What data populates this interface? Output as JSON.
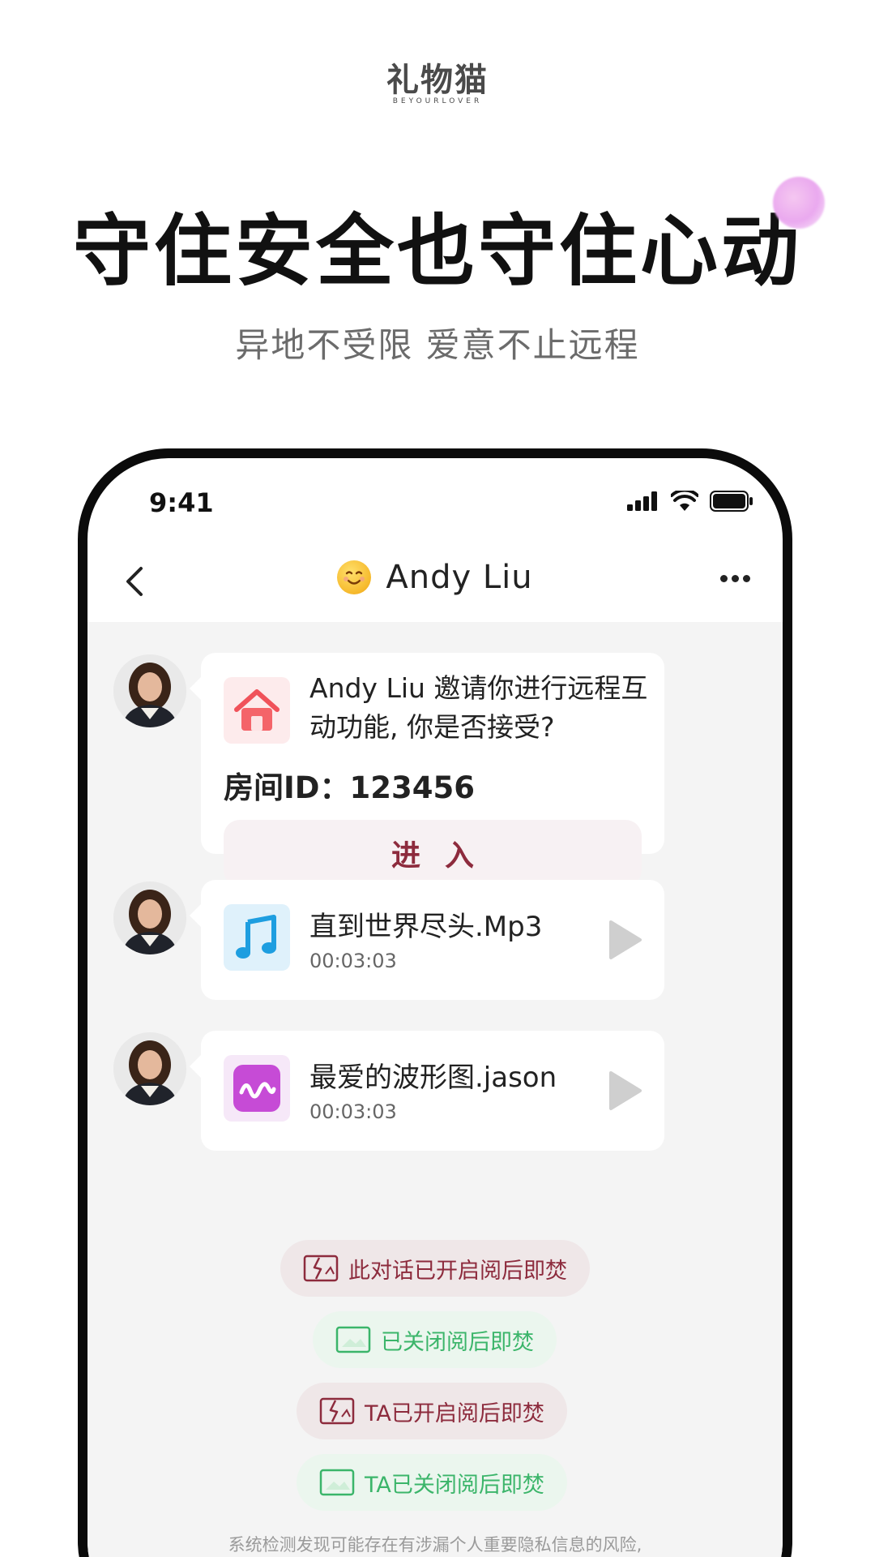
{
  "brand": {
    "name": "礼物猫",
    "tagline": "BEYOURLOVER"
  },
  "headline": "守住安全也守住心动",
  "subheadline": "异地不受限 爱意不止远程",
  "status_bar": {
    "time": "9:41"
  },
  "chat": {
    "title": "Andy Liu",
    "invite": {
      "text": "Andy Liu 邀请你进行远程互动功能, 你是否接受?",
      "room_id": "房间ID：123456",
      "enter_label": "进入"
    },
    "files": [
      {
        "name": "直到世界尽头.Mp3",
        "duration": "00:03:03",
        "icon": "music-note-icon"
      },
      {
        "name": "最爱的波形图.jason",
        "duration": "00:03:03",
        "icon": "waveform-icon"
      }
    ],
    "system_messages": [
      {
        "text": "此对话已开启阅后即焚",
        "style": "red"
      },
      {
        "text": "已关闭阅后即焚",
        "style": "green"
      },
      {
        "text": "TA已开启阅后即焚",
        "style": "red"
      },
      {
        "text": "TA已关闭阅后即焚",
        "style": "green"
      }
    ],
    "warning": "系统检测发现可能存在有涉漏个人重要隐私信息的风险,"
  },
  "colors": {
    "accent_red": "#8d2b3d",
    "accent_green": "#3bb56a",
    "chat_bg": "#f4f4f4"
  }
}
